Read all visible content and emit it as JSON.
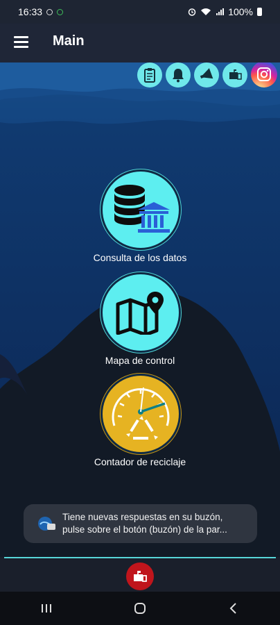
{
  "status_bar": {
    "time": "16:33",
    "battery": "100%"
  },
  "app_bar": {
    "title": "Main"
  },
  "quick_icons": [
    {
      "name": "clipboard-icon"
    },
    {
      "name": "bell-icon"
    },
    {
      "name": "megaphone-icon"
    },
    {
      "name": "mailbox-icon"
    },
    {
      "name": "instagram-icon"
    }
  ],
  "menu": [
    {
      "label": "Consulta de los datos",
      "icon": "database-bank-icon"
    },
    {
      "label": "Mapa de control",
      "icon": "map-pin-icon"
    },
    {
      "label": "Contador de reciclaje",
      "icon": "recycling-gauge-icon"
    }
  ],
  "toast": {
    "text": "Tiene nuevas respuestas en su buzón,\npulse sobre el botón (buzón) de la par..."
  },
  "colors": {
    "accent_cyan": "#5deef0",
    "gold": "#e6b322",
    "mailbox_red": "#c0151c",
    "background_blue": "#0e2a56"
  }
}
